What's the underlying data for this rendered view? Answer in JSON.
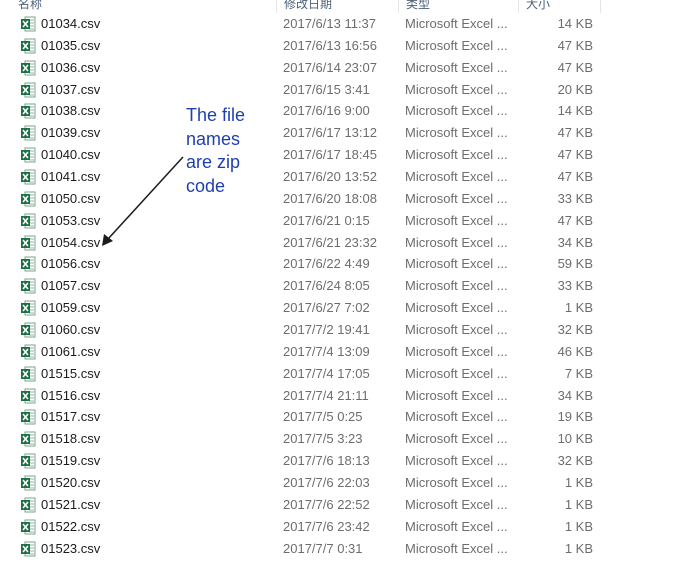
{
  "columns": {
    "name": "名称",
    "date": "修改日期",
    "type": "类型",
    "size": "大小"
  },
  "files": [
    {
      "name": "01034.csv",
      "date": "2017/6/13 11:37",
      "type": "Microsoft Excel ...",
      "size": "14 KB"
    },
    {
      "name": "01035.csv",
      "date": "2017/6/13 16:56",
      "type": "Microsoft Excel ...",
      "size": "47 KB"
    },
    {
      "name": "01036.csv",
      "date": "2017/6/14 23:07",
      "type": "Microsoft Excel ...",
      "size": "47 KB"
    },
    {
      "name": "01037.csv",
      "date": "2017/6/15 3:41",
      "type": "Microsoft Excel ...",
      "size": "20 KB"
    },
    {
      "name": "01038.csv",
      "date": "2017/6/16 9:00",
      "type": "Microsoft Excel ...",
      "size": "14 KB"
    },
    {
      "name": "01039.csv",
      "date": "2017/6/17 13:12",
      "type": "Microsoft Excel ...",
      "size": "47 KB"
    },
    {
      "name": "01040.csv",
      "date": "2017/6/17 18:45",
      "type": "Microsoft Excel ...",
      "size": "47 KB"
    },
    {
      "name": "01041.csv",
      "date": "2017/6/20 13:52",
      "type": "Microsoft Excel ...",
      "size": "47 KB"
    },
    {
      "name": "01050.csv",
      "date": "2017/6/20 18:08",
      "type": "Microsoft Excel ...",
      "size": "33 KB"
    },
    {
      "name": "01053.csv",
      "date": "2017/6/21 0:15",
      "type": "Microsoft Excel ...",
      "size": "47 KB"
    },
    {
      "name": "01054.csv",
      "date": "2017/6/21 23:32",
      "type": "Microsoft Excel ...",
      "size": "34 KB"
    },
    {
      "name": "01056.csv",
      "date": "2017/6/22 4:49",
      "type": "Microsoft Excel ...",
      "size": "59 KB"
    },
    {
      "name": "01057.csv",
      "date": "2017/6/24 8:05",
      "type": "Microsoft Excel ...",
      "size": "33 KB"
    },
    {
      "name": "01059.csv",
      "date": "2017/6/27 7:02",
      "type": "Microsoft Excel ...",
      "size": "1 KB"
    },
    {
      "name": "01060.csv",
      "date": "2017/7/2 19:41",
      "type": "Microsoft Excel ...",
      "size": "32 KB"
    },
    {
      "name": "01061.csv",
      "date": "2017/7/4 13:09",
      "type": "Microsoft Excel ...",
      "size": "46 KB"
    },
    {
      "name": "01515.csv",
      "date": "2017/7/4 17:05",
      "type": "Microsoft Excel ...",
      "size": "7 KB"
    },
    {
      "name": "01516.csv",
      "date": "2017/7/4 21:11",
      "type": "Microsoft Excel ...",
      "size": "34 KB"
    },
    {
      "name": "01517.csv",
      "date": "2017/7/5 0:25",
      "type": "Microsoft Excel ...",
      "size": "19 KB"
    },
    {
      "name": "01518.csv",
      "date": "2017/7/5 3:23",
      "type": "Microsoft Excel ...",
      "size": "10 KB"
    },
    {
      "name": "01519.csv",
      "date": "2017/7/6 18:13",
      "type": "Microsoft Excel ...",
      "size": "32 KB"
    },
    {
      "name": "01520.csv",
      "date": "2017/7/6 22:03",
      "type": "Microsoft Excel ...",
      "size": "1 KB"
    },
    {
      "name": "01521.csv",
      "date": "2017/7/6 22:52",
      "type": "Microsoft Excel ...",
      "size": "1 KB"
    },
    {
      "name": "01522.csv",
      "date": "2017/7/6 23:42",
      "type": "Microsoft Excel ...",
      "size": "1 KB"
    },
    {
      "name": "01523.csv",
      "date": "2017/7/7 0:31",
      "type": "Microsoft Excel ...",
      "size": "1 KB"
    }
  ],
  "annotation": {
    "text": "The file\nnames\nare zip\ncode",
    "color": "#1f3fae"
  },
  "icons": {
    "file": "excel-csv-icon"
  },
  "colors": {
    "excel_green": "#1d7044",
    "header_text": "#4c607a",
    "meta_text": "#6d6d6d"
  }
}
